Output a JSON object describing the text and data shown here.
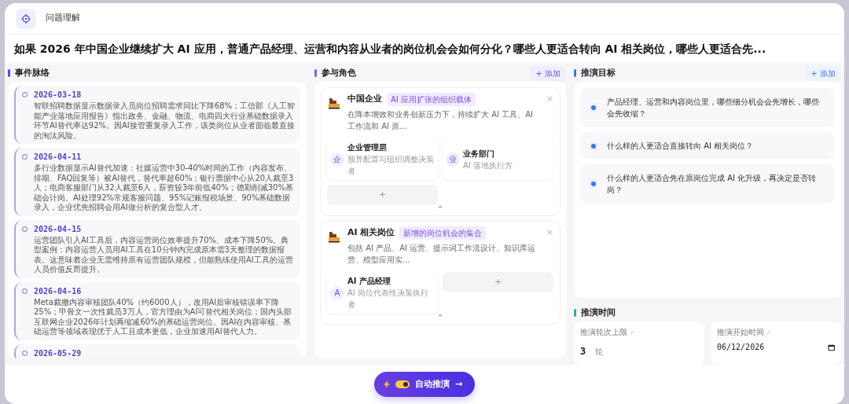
{
  "header": {
    "title": "问题理解"
  },
  "question": "如果 2026 年中国企业继续扩大 AI 应用，普通产品经理、运营和内容从业者的岗位机会会如何分化？哪些人更适合转向 AI 相关岗位，哪些人更适合先...",
  "timeline": {
    "title": "事件脉络",
    "events": [
      {
        "date": "2026-03-18",
        "text": "智联招聘数据显示数据录入员岗位招聘需求同比下降68%；工信部《人工智能产业落地应用报告》指出政务、金融、物流、电商四大行业基础数据录入环节AI替代率达92%。因AI接管重复录入工作，该类岗位从业者面临最直接的淘汰风险。"
      },
      {
        "date": "2026-04-11",
        "text": "多行业数据显示AI替代加速：社媒运营中30-40%时间的工作（内容发布、排期、FAQ回复等）被AI替代，替代率超60%；银行票据中心从20人裁至3人；电商客服部门从32人裁至6人，薪资较3年前低40%；德勤削减30%基础会计岗。AI处理92%常规客服问题、95%记账报税场景、90%基础数据录入，企业优先招聘会用AI做分析的复合型人才。"
      },
      {
        "date": "2026-04-15",
        "text": "运营团队引入AI工具后，内容运营岗位效率提升70%、成本下降50%。典型案例：内容运营人员用AI工具在10分钟内完成原本需3天整理的数据报表。这意味着企业无需维持原有运营团队规模，但能熟练使用AI工具的运营人员价值反而提升。"
      },
      {
        "date": "2026-04-16",
        "text": "Meta裁撤内容审核团队40%（约6000人），改用AI后审核错误率下降25%；甲骨文一次性裁员3万人，官方理由为AI可替代相关岗位；国内头部互联网企业2026年计划再缩减60%的基础运营岗位。因AI在内容审核、基础运营等领域表现优于人工且成本更低，企业加速用AI替代人力。"
      },
      {
        "date": "2026-05-29"
      }
    ]
  },
  "roles": {
    "title": "参与角色",
    "add_label": "+ 添加",
    "groups": [
      {
        "name": "中国企业",
        "tag": "AI 应用扩张的组织载体",
        "desc": "在降本增效和业务创新压力下，持续扩大 AI 工具、AI 工作流和 AI 原...",
        "close": "×",
        "collapse": "⌃",
        "members": [
          {
            "icon_char": "企",
            "name": "企业管理层",
            "desc": "预算配置与组织调整决策者"
          },
          {
            "icon_char": "业",
            "name": "业务部门",
            "desc": "AI 落地执行方"
          }
        ],
        "add_char": "+"
      },
      {
        "name": "AI 相关岗位",
        "tag": "新增的岗位机会的集合",
        "desc": "包括 AI 产品、AI 运营、提示词工作流设计、知识库运营、模型应用实...",
        "close": "×",
        "collapse": "⌃",
        "members": [
          {
            "icon_char": "A",
            "name": "AI 产品经理",
            "desc": "AI 岗位代表性决策执行者"
          }
        ],
        "add_char": "+"
      }
    ]
  },
  "goals": {
    "title": "推演目标",
    "add_label": "+ 添加",
    "items": [
      "产品经理、运营和内容岗位里，哪些细分机会会先增长，哪些会先收缩？",
      "什么样的人更适合直接转向 AI 相关岗位？",
      "什么样的人更适合先在原岗位完成 AI 化升级，再决定是否转岗？"
    ]
  },
  "timing": {
    "title": "推演时间",
    "rounds": {
      "label": "推演轮次上限",
      "value": "3",
      "unit": "轮"
    },
    "start": {
      "label": "推演开始时间",
      "value": "06/12/2026"
    }
  },
  "action": {
    "label": "自动推演",
    "arrow": "→",
    "auto_on": true
  }
}
